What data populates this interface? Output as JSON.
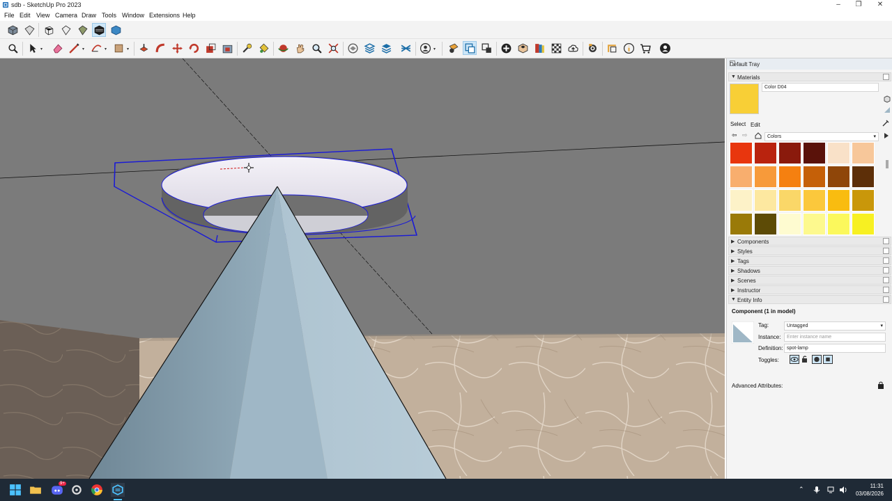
{
  "window": {
    "title": "sdb - SketchUp Pro 2023",
    "min": "–",
    "max": "❐",
    "close": "✕"
  },
  "menu": [
    "File",
    "Edit",
    "View",
    "Camera",
    "Draw",
    "Tools",
    "Window",
    "Extensions",
    "Help"
  ],
  "toolbar_views": [
    "iso-view-icon",
    "top-view-icon",
    "front-view-icon",
    "right-view-icon",
    "back-view-icon",
    "left-view-icon",
    "bottom-view-icon"
  ],
  "tray": {
    "title": "Default Tray",
    "materials": {
      "header": "Materials",
      "current_name": "Color D04",
      "current_color": "#f8cf36",
      "tab_select": "Select",
      "tab_edit": "Edit",
      "library": "Colors",
      "swatches": [
        [
          "#e8360e",
          "#b9230e",
          "#8a1a0c",
          "#5a120a",
          "#f9e1c8",
          "#f7c79a"
        ],
        [
          "#f8ae6e",
          "#f79a3a",
          "#f58010",
          "#c56008",
          "#8f4609",
          "#5d2f08"
        ],
        [
          "#fdf2c8",
          "#fde8a0",
          "#fad768",
          "#fbc83c",
          "#f9bc10",
          "#c9970a"
        ],
        [
          "#9a7a08",
          "#5d4b06",
          "#fefbd0",
          "#fdf98e",
          "#fbf85c",
          "#f7f022"
        ]
      ]
    },
    "panels": [
      "Components",
      "Styles",
      "Tags",
      "Shadows",
      "Scenes",
      "Instructor"
    ],
    "entity_info": {
      "header": "Entity Info",
      "title": "Component (1 in model)",
      "tag_label": "Tag:",
      "tag_value": "Untagged",
      "instance_label": "Instance:",
      "instance_placeholder": "Enter instance name",
      "definition_label": "Definition:",
      "definition_value": "spot-lamp",
      "toggles_label": "Toggles:",
      "advanced": "Advanced Attributes:"
    }
  },
  "taskbar": {
    "time": "11:31",
    "date": "03/08/2026",
    "discord_badge": "9+"
  }
}
